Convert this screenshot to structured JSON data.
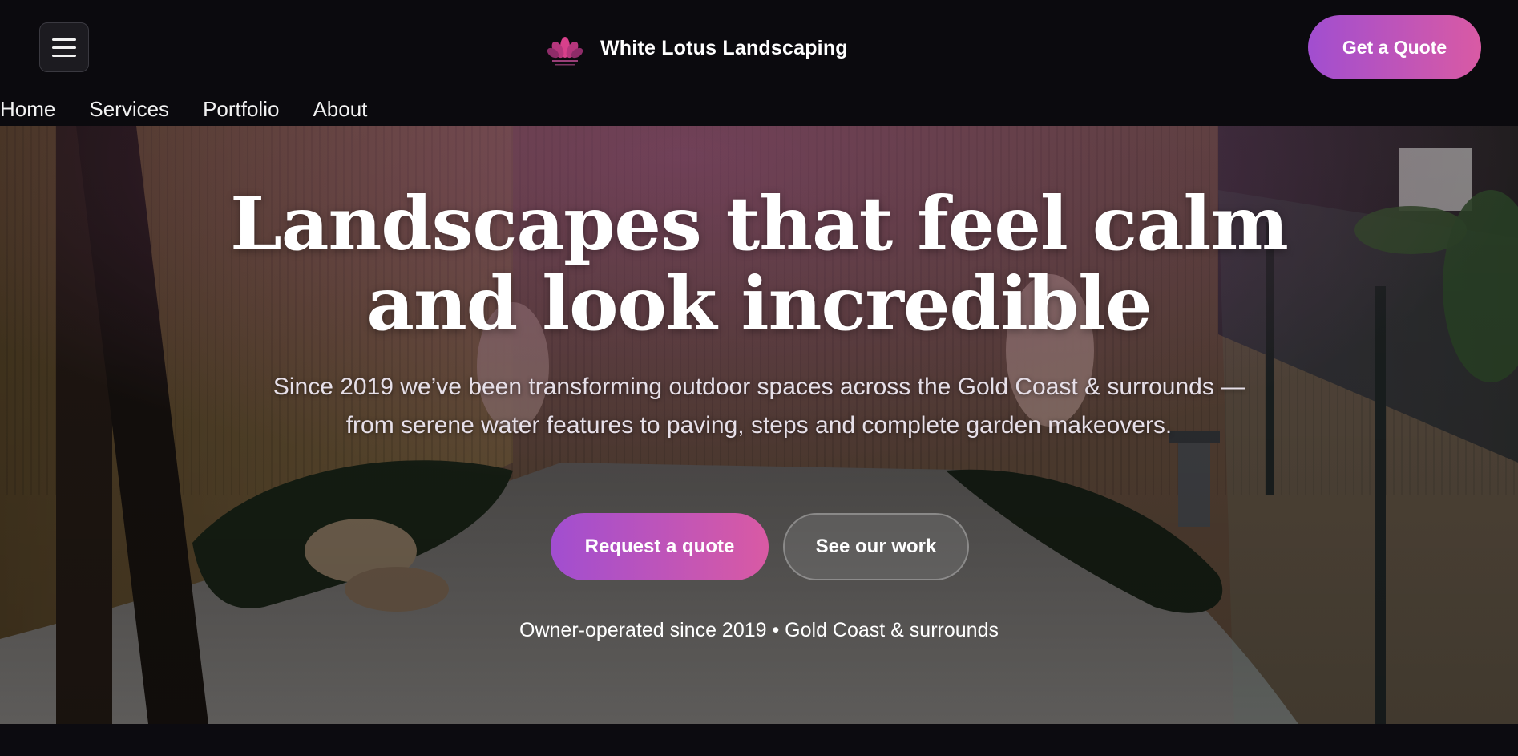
{
  "header": {
    "menu_icon": "hamburger-menu-icon",
    "brand_name": "White Lotus Landscaping",
    "logo_icon": "lotus-flower-logo",
    "quote_button": "Get a Quote"
  },
  "nav": {
    "items": [
      "Home",
      "Services",
      "Portfolio",
      "About"
    ]
  },
  "hero": {
    "title_line1": "Landscapes that feel calm",
    "title_line2": "and look incredible",
    "subtitle": "Since 2019 we’ve been transforming outdoor spaces across the Gold Coast & surrounds — from serene water features to paving, steps and complete garden makeovers.",
    "primary_button": "Request a quote",
    "secondary_button": "See our work",
    "note": "Owner-operated since 2019 • Gold Coast & surrounds"
  },
  "colors": {
    "accent_start": "#a14ed0",
    "accent_end": "#d95aa4",
    "background": "#0b0a0e"
  }
}
